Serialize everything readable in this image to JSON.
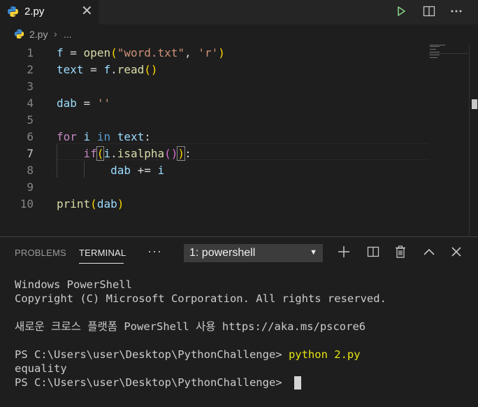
{
  "tab": {
    "filename": "2.py"
  },
  "breadcrumb": {
    "filename": "2.py",
    "ellipsis": "..."
  },
  "editor": {
    "line_numbers": [
      "1",
      "2",
      "3",
      "4",
      "5",
      "6",
      "7",
      "8",
      "9",
      "10"
    ],
    "active_line": "7"
  },
  "panel": {
    "tabs": {
      "problems": "PROBLEMS",
      "terminal": "TERMINAL",
      "more": "···"
    },
    "terminal_select": "1: powershell"
  },
  "terminal": {
    "lines": [
      "Windows PowerShell",
      "Copyright (C) Microsoft Corporation. All rights reserved.",
      "",
      "새로운 크로스 플랫폼 PowerShell 사용 https://aka.ms/pscore6",
      "",
      "PS C:\\Users\\user\\Desktop\\PythonChallenge> ",
      "equality",
      "PS C:\\Users\\user\\Desktop\\PythonChallenge> "
    ],
    "command": "python 2.py"
  },
  "colors": {
    "background": "#1e1e1e",
    "run_button": "#89d185",
    "python_blue": "#3572a5",
    "python_yellow": "#ffd43b"
  }
}
